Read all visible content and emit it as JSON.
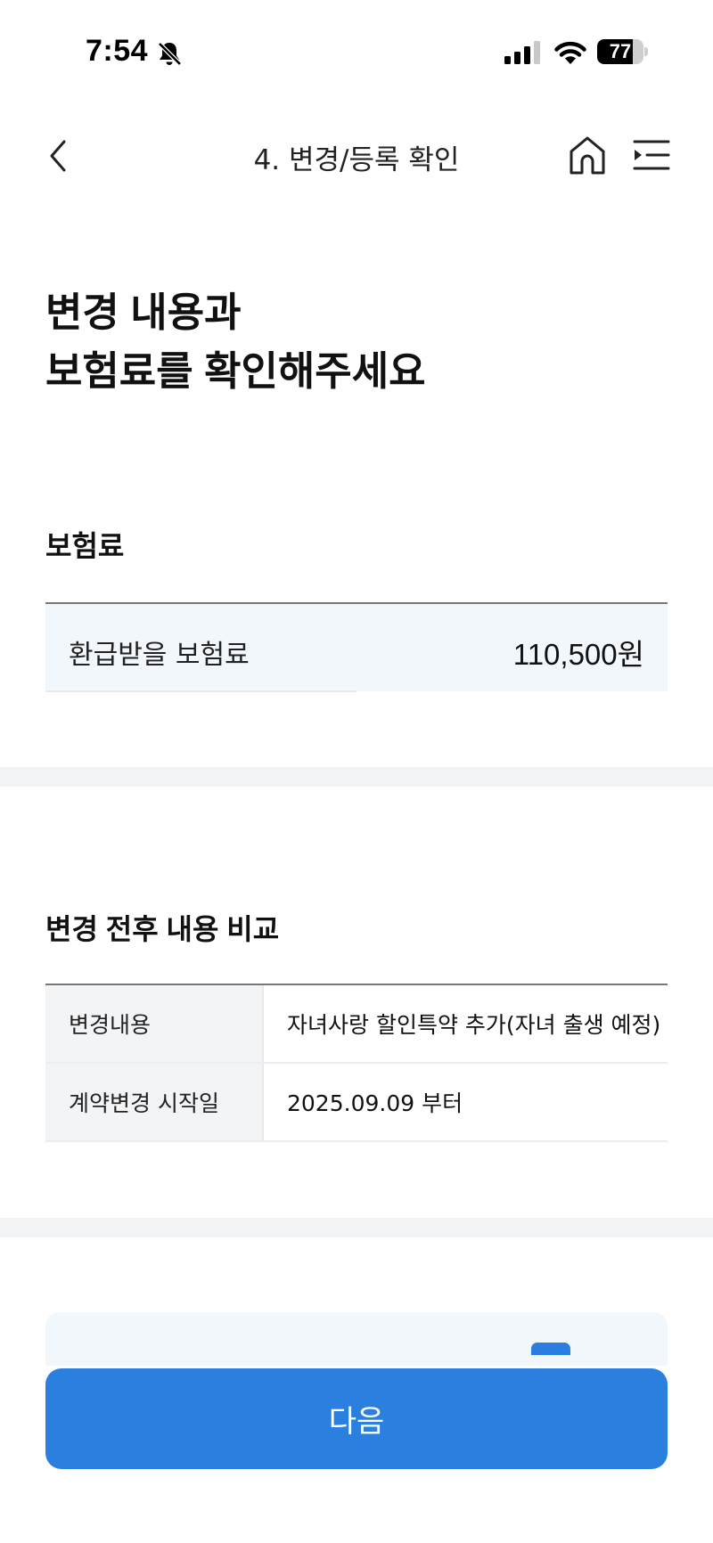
{
  "status_bar": {
    "time": "7:54",
    "battery": "77",
    "battery_level": 0.77,
    "icons": [
      "bell-off-icon",
      "cellular-signal-icon",
      "wifi-icon",
      "battery-icon"
    ]
  },
  "nav": {
    "title": "4. 변경/등록 확인",
    "icons": [
      "chevron-left-icon",
      "home-icon",
      "menu-icon"
    ]
  },
  "headline": {
    "line1": "변경 내용과",
    "line2": "보험료를 확인해주세요"
  },
  "premium": {
    "title": "보험료",
    "label": "환급받을 보험료",
    "value": "110,500원"
  },
  "comparison": {
    "title": "변경 전후 내용 비교",
    "rows": [
      {
        "label": "변경내용",
        "value": "자녀사랑 할인특약 추가(자녀 출생 예정)"
      },
      {
        "label": "계약변경 시작일",
        "value": "2025.09.09 부터"
      }
    ]
  },
  "cta": {
    "next_label": "다음"
  },
  "colors": {
    "accent": "#2b7fdf",
    "light_panel": "#f2f7fc",
    "divider": "#f2f4f6"
  }
}
